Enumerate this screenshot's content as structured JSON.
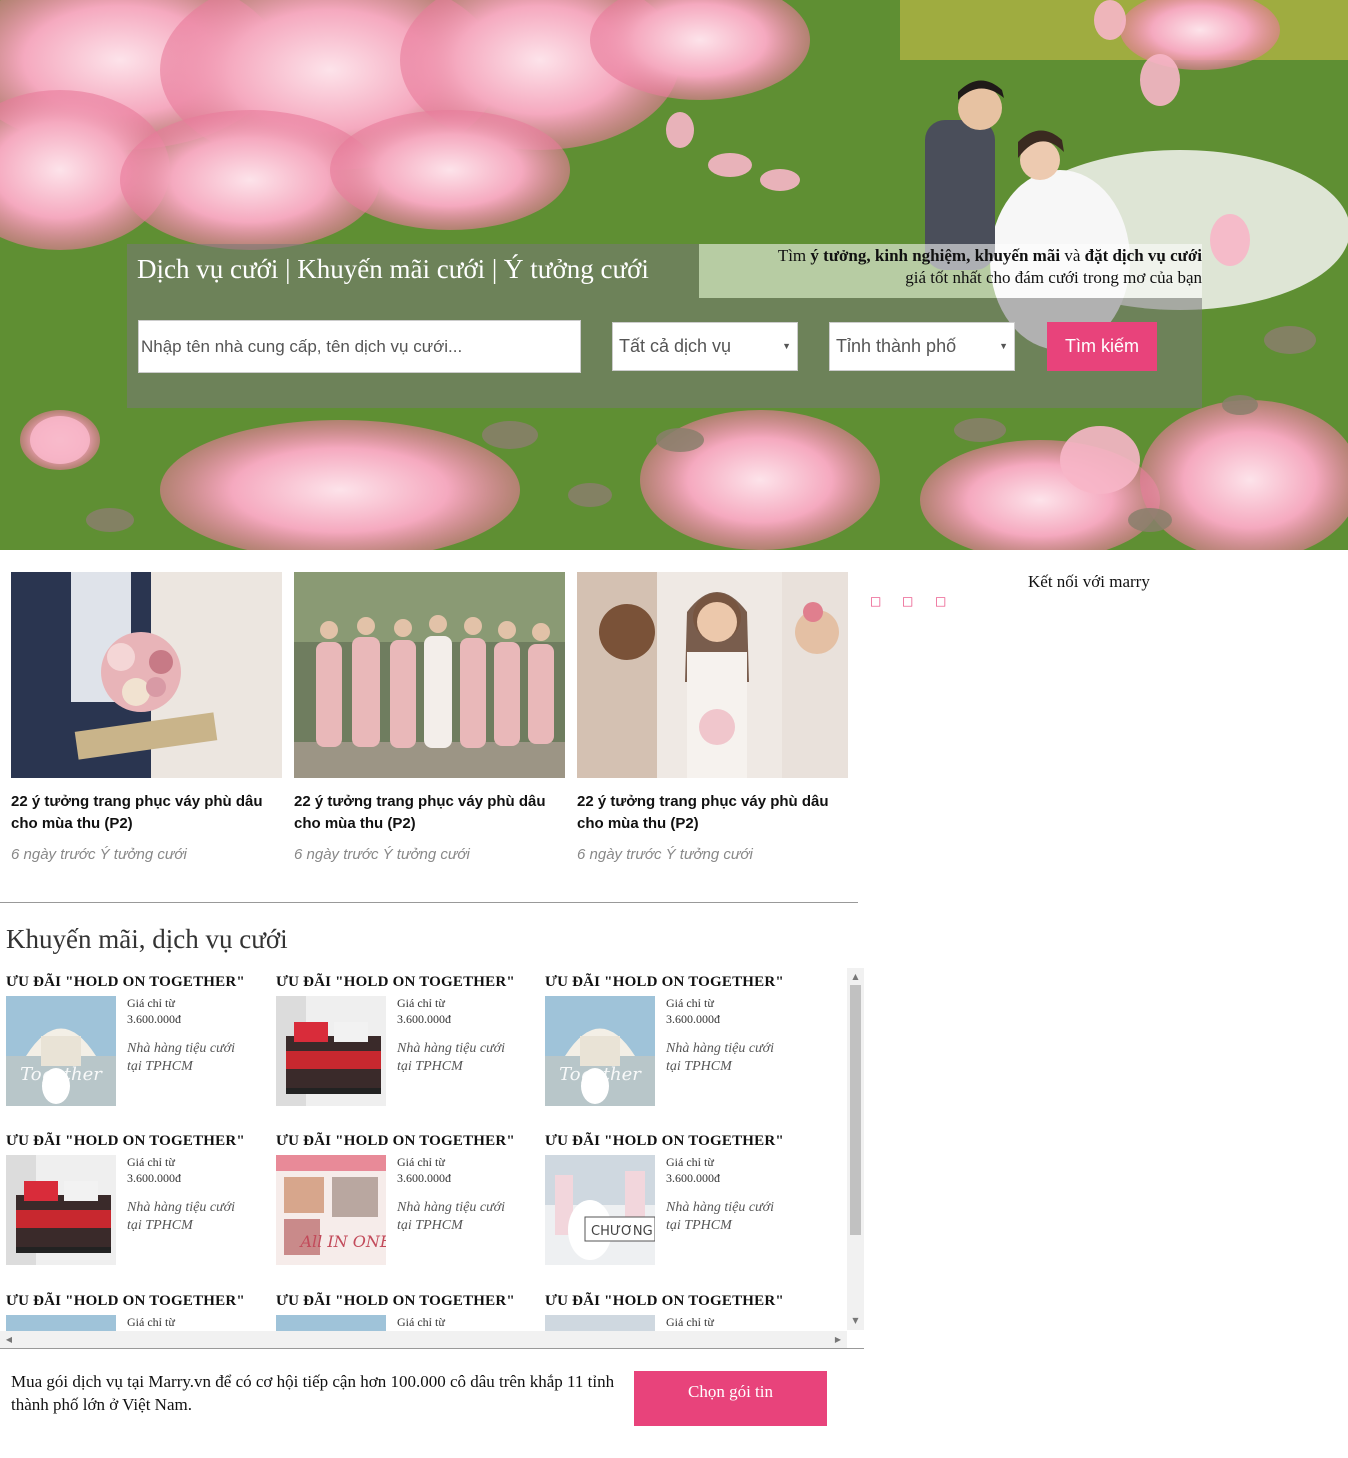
{
  "hero": {
    "title": "Dịch vụ cưới | Khuyến mãi cưới | Ý tưởng cưới",
    "tagline_1a": "Tìm ",
    "tagline_1b": "ý tưởng, kinh nghiệm, khuyến mãi",
    "tagline_1c": " và ",
    "tagline_1d": "đặt dịch vụ cưới",
    "tagline_2": "giá tốt nhất cho đám cưới trong mơ của bạn",
    "search_placeholder": "Nhập tên nhà cung cấp, tên dịch vụ cưới...",
    "service_select": "Tất cả dịch vụ",
    "city_select": "Tỉnh thành phố",
    "search_button": "Tìm kiếm"
  },
  "articles": [
    {
      "title": "22 ý tưởng trang phục váy phù dâu cho mùa thu (P2)",
      "meta": "6 ngày trước Ý tưởng cưới"
    },
    {
      "title": "22 ý tưởng trang phục váy phù dâu cho mùa thu (P2)",
      "meta": "6 ngày trước Ý tưởng cưới"
    },
    {
      "title": "22 ý tưởng trang phục váy phù dâu cho mùa thu (P2)",
      "meta": "6 ngày trước Ý tưởng cưới"
    }
  ],
  "sidebar": {
    "title": "Kết nối với marry",
    "social_icons": [
      "facebook-icon",
      "twitter-icon",
      "google-icon"
    ],
    "social_glyph": "□"
  },
  "promotions": {
    "section_title": "Khuyến mãi, dịch vụ cưới",
    "items": [
      {
        "title": "ƯU ĐÃI \"HOLD ON TOGETHER\"",
        "price_label": "Giá chỉ từ",
        "price": "3.600.000đ",
        "desc": "Nhà hàng tiệu cưới tại TPHCM",
        "img": "wedding"
      },
      {
        "title": "ƯU ĐÃI \"HOLD ON TOGETHER\"",
        "price_label": "Giá chỉ từ",
        "price": "3.600.000đ",
        "desc": "Nhà hàng tiệu cưới tại TPHCM",
        "img": "bedding"
      },
      {
        "title": "ƯU ĐÃI \"HOLD ON TOGETHER\"",
        "price_label": "Giá chỉ từ",
        "price": "3.600.000đ",
        "desc": "Nhà hàng tiệu cưới tại TPHCM",
        "img": "wedding"
      },
      {
        "title": "ƯU ĐÃI \"HOLD ON TOGETHER\"",
        "price_label": "Giá chỉ từ",
        "price": "3.600.000đ",
        "desc": "Nhà hàng tiệu cưới tại TPHCM",
        "img": "bedding"
      },
      {
        "title": "ƯU ĐÃI \"HOLD ON TOGETHER\"",
        "price_label": "Giá chỉ từ",
        "price": "3.600.000đ",
        "desc": "Nhà hàng tiệu cưới tại TPHCM",
        "img": "allinone"
      },
      {
        "title": "ƯU ĐÃI \"HOLD ON TOGETHER\"",
        "price_label": "Giá chỉ từ",
        "price": "3.600.000đ",
        "desc": "Nhà hàng tiệu cưới tại TPHCM",
        "img": "chuong"
      },
      {
        "title": "ƯU ĐÃI \"HOLD ON TOGETHER\"",
        "price_label": "Giá chỉ từ",
        "price": "",
        "desc": "",
        "img": "wedding"
      },
      {
        "title": "ƯU ĐÃI \"HOLD ON TOGETHER\"",
        "price_label": "Giá chỉ từ",
        "price": "",
        "desc": "",
        "img": "wedding"
      },
      {
        "title": "ƯU ĐÃI \"HOLD ON TOGETHER\"",
        "price_label": "Giá chỉ từ",
        "price": "",
        "desc": "",
        "img": "chuong"
      }
    ],
    "img_text_together": "Together",
    "img_text_allinone": "All IN ONE",
    "img_text_chuong": "CHƯƠNG"
  },
  "cta": {
    "text": "Mua gói dịch vụ tại Marry.vn để có cơ hội tiếp cận hơn 100.000 cô dâu trên khắp 11 tỉnh thành phố lớn ở Việt Nam.",
    "button": "Chọn gói tin"
  },
  "colors": {
    "accent": "#e8437b"
  }
}
